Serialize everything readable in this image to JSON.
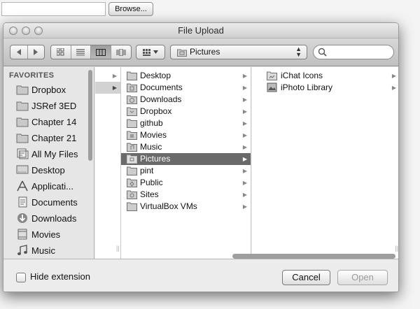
{
  "page": {
    "browse_input_value": "",
    "browse_label": "Browse..."
  },
  "window": {
    "title": "File Upload"
  },
  "toolbar": {
    "location_popup": "Pictures",
    "search_value": "",
    "view_modes": [
      "icon",
      "list",
      "column",
      "coverflow"
    ],
    "active_view": "column"
  },
  "sidebar": {
    "heading": "FAVORITES",
    "items": [
      {
        "label": "Dropbox",
        "icon": "folder-icon"
      },
      {
        "label": "JSRef 3ED",
        "icon": "folder-icon"
      },
      {
        "label": "Chapter 14",
        "icon": "folder-icon"
      },
      {
        "label": "Chapter 21",
        "icon": "folder-icon"
      },
      {
        "label": "All My Files",
        "icon": "all-files-icon"
      },
      {
        "label": "Desktop",
        "icon": "desktop-icon"
      },
      {
        "label": "Applicati...",
        "icon": "applications-icon"
      },
      {
        "label": "Documents",
        "icon": "documents-icon"
      },
      {
        "label": "Downloads",
        "icon": "downloads-icon"
      },
      {
        "label": "Movies",
        "icon": "movies-icon"
      },
      {
        "label": "Music",
        "icon": "music-icon"
      }
    ]
  },
  "columns": {
    "home": [
      {
        "label": "Desktop"
      },
      {
        "label": "Documents"
      },
      {
        "label": "Downloads"
      },
      {
        "label": "Dropbox"
      },
      {
        "label": "github"
      },
      {
        "label": "Movies"
      },
      {
        "label": "Music"
      },
      {
        "label": "Pictures",
        "selected": true
      },
      {
        "label": "pint"
      },
      {
        "label": "Public"
      },
      {
        "label": "Sites"
      },
      {
        "label": "VirtualBox VMs"
      }
    ],
    "pictures": [
      {
        "label": "iChat Icons"
      },
      {
        "label": "iPhoto Library"
      }
    ]
  },
  "footer": {
    "hide_extension_label": "Hide extension",
    "hide_extension_checked": false,
    "cancel_label": "Cancel",
    "open_label": "Open",
    "open_enabled": false
  },
  "colors": {
    "selection": "#6a6a6a",
    "sidebar_bg": "#e6e6e6",
    "window_bg": "#ececec"
  }
}
